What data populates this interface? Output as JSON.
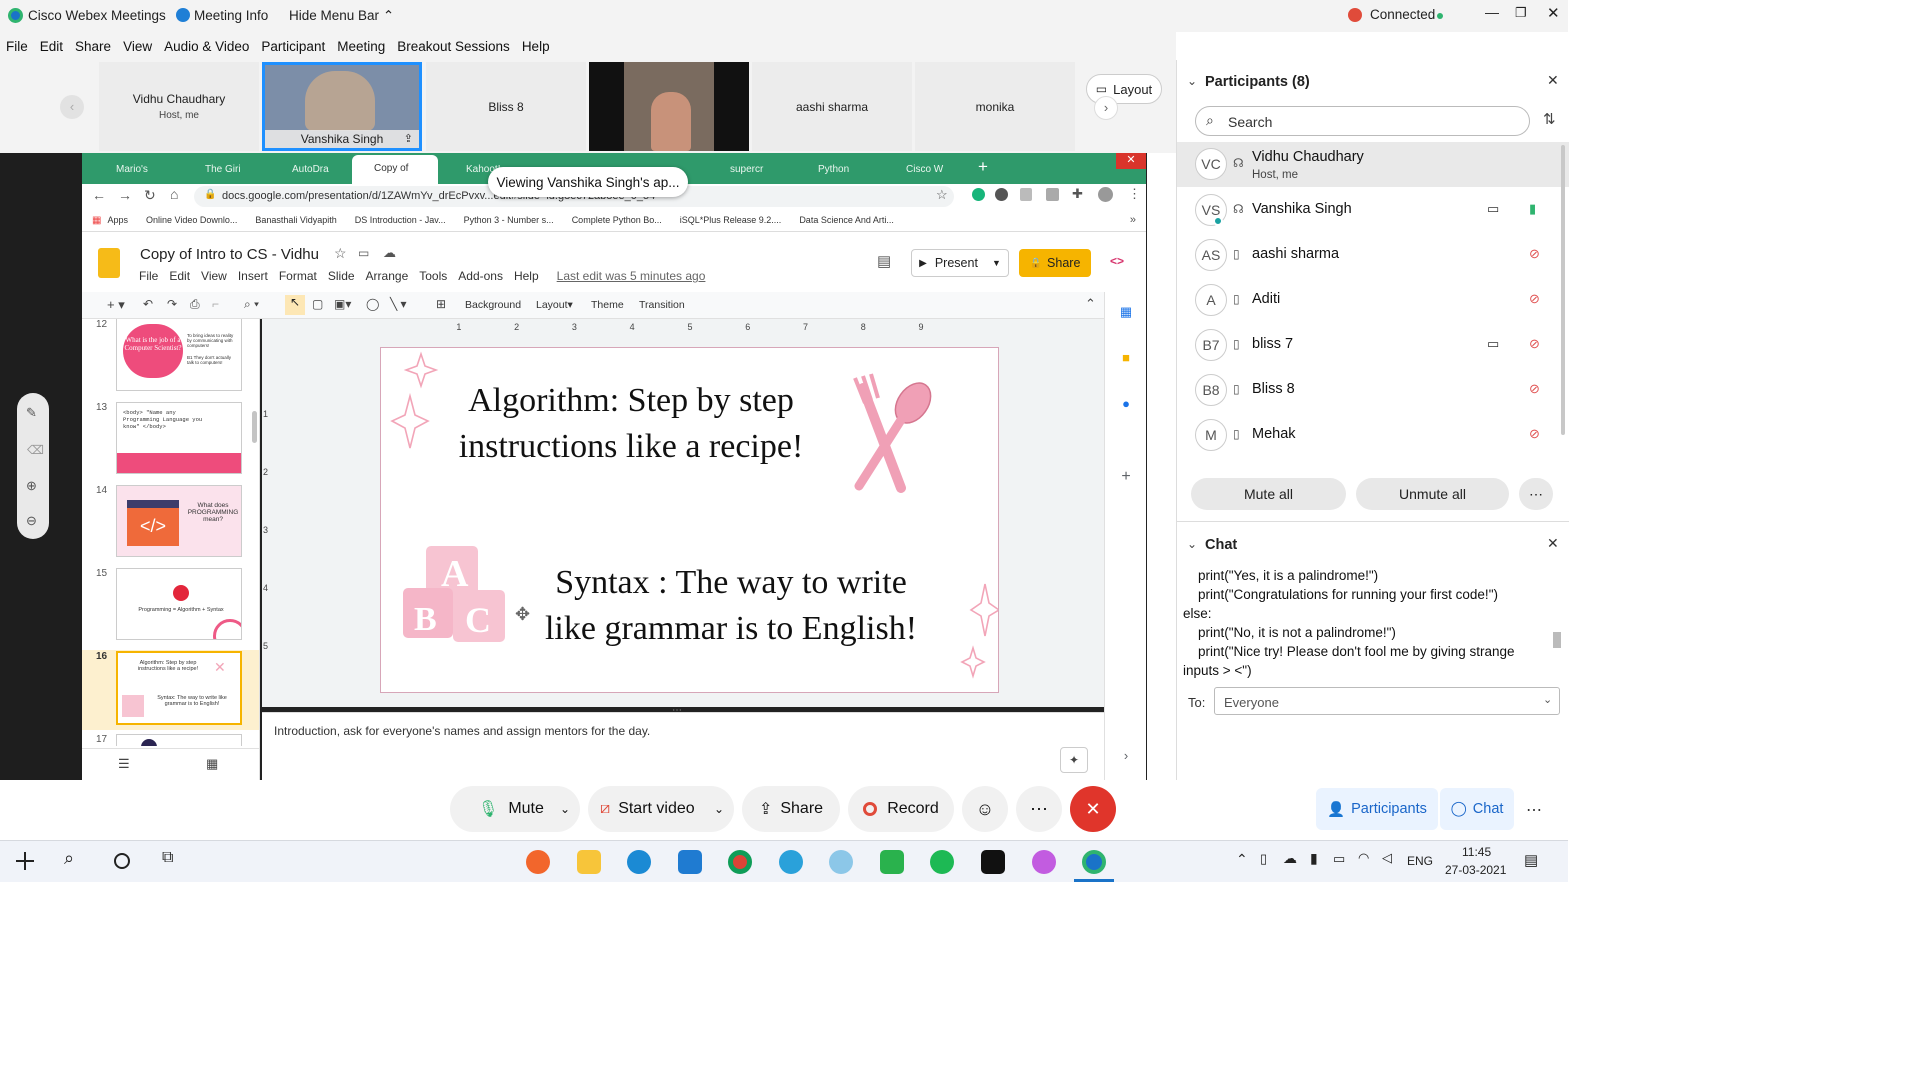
{
  "titlebar": {
    "app": "Cisco Webex Meetings",
    "meeting_info": "Meeting Info",
    "hide_menu": "Hide Menu Bar",
    "status": "Connected"
  },
  "menu": [
    "File",
    "Edit",
    "Share",
    "View",
    "Audio & Video",
    "Participant",
    "Meeting",
    "Breakout Sessions",
    "Help"
  ],
  "video_tiles": [
    {
      "name": "Vidhu Chaudhary",
      "sub": "Host, me"
    },
    {
      "name": "Vanshika Singh"
    },
    {
      "name": "Bliss 8"
    },
    {
      "name": ""
    },
    {
      "name": "aashi sharma"
    },
    {
      "name": "monika"
    }
  ],
  "layout_button": "Layout",
  "viewing_banner": "Viewing Vanshika Singh's ap...",
  "browser": {
    "tabs": [
      "Mario's",
      "The Giri",
      "AutoDra",
      "Copy of",
      "Kahoot!",
      "supercr",
      "Python",
      "Cisco W"
    ],
    "url": "docs.google.com/presentation/d/1ZAWmYv_drEcPvxv...edit#slide=id.g8ec72ab8ee_0_54",
    "bookmarks": [
      "Apps",
      "Online Video Downlo...",
      "Banasthali Vidyapith",
      "DS Introduction - Jav...",
      "Python 3 - Number s...",
      "Complete Python Bo...",
      "iSQL*Plus Release 9.2....",
      "Data Science And Arti..."
    ]
  },
  "slides": {
    "doc_title": "Copy of Intro to CS - Vidhu",
    "menu": [
      "File",
      "Edit",
      "View",
      "Insert",
      "Format",
      "Slide",
      "Arrange",
      "Tools",
      "Add-ons",
      "Help"
    ],
    "last_edit": "Last edit was 5 minutes ago",
    "present": "Present",
    "share": "Share",
    "toolbar": [
      "Background",
      "Layout",
      "Theme",
      "Transition"
    ],
    "ruler": [
      "1",
      "2",
      "3",
      "4",
      "5",
      "6",
      "7",
      "8",
      "9"
    ],
    "vruler": [
      "1",
      "2",
      "3",
      "4",
      "5"
    ],
    "thumb_numbers": [
      "12",
      "13",
      "14",
      "15",
      "16",
      "17"
    ],
    "thumb_texts": {
      "t12a": "What is the job of a Computer Scientist?",
      "t12b": "To bring ideas to reality by communicating with computers!",
      "t12c": "B1 They don't actually talk to computers!",
      "t13": "<body> \"Name any Programming Language you know\" </body>",
      "t14a": "What does PROGRAMMING mean?",
      "t15": "Programming = Algorithm + Syntax",
      "t16a": "Algorithm: Step by step instructions like a recipe!",
      "t16b": "Syntax: The way to write like grammar is to English!"
    },
    "current": {
      "line1": "Algorithm: Step by step",
      "line2": "instructions like a recipe!",
      "line3": "Syntax : The way to write",
      "line4": "like grammar is to English!"
    },
    "notes": "Introduction, ask for everyone's names and assign mentors for the day."
  },
  "participants": {
    "header": "Participants (8)",
    "search_placeholder": "Search",
    "list": [
      {
        "initials": "VC",
        "name": "Vidhu Chaudhary",
        "sub": "Host, me"
      },
      {
        "initials": "VS",
        "name": "Vanshika Singh"
      },
      {
        "initials": "AS",
        "name": "aashi sharma"
      },
      {
        "initials": "A",
        "name": "Aditi"
      },
      {
        "initials": "B7",
        "name": "bliss 7"
      },
      {
        "initials": "B8",
        "name": "Bliss 8"
      },
      {
        "initials": "M",
        "name": "Mehak"
      }
    ],
    "mute_all": "Mute all",
    "unmute_all": "Unmute all"
  },
  "chat": {
    "header": "Chat",
    "lines": [
      "    print(\"Yes, it is a palindrome!\")",
      "    print(\"Congratulations for running your first code!\")",
      "else:",
      "    print(\"No, it is not a palindrome!\")",
      "    print(\"Nice try! Please don't fool me by giving strange",
      "inputs > <\")"
    ],
    "to_label": "To:",
    "to_value": "Everyone"
  },
  "controls": {
    "mute": "Mute",
    "start_video": "Start video",
    "share": "Share",
    "record": "Record",
    "participants": "Participants",
    "chat": "Chat"
  },
  "taskbar": {
    "lang": "ENG",
    "time": "11:45",
    "date": "27-03-2021"
  }
}
